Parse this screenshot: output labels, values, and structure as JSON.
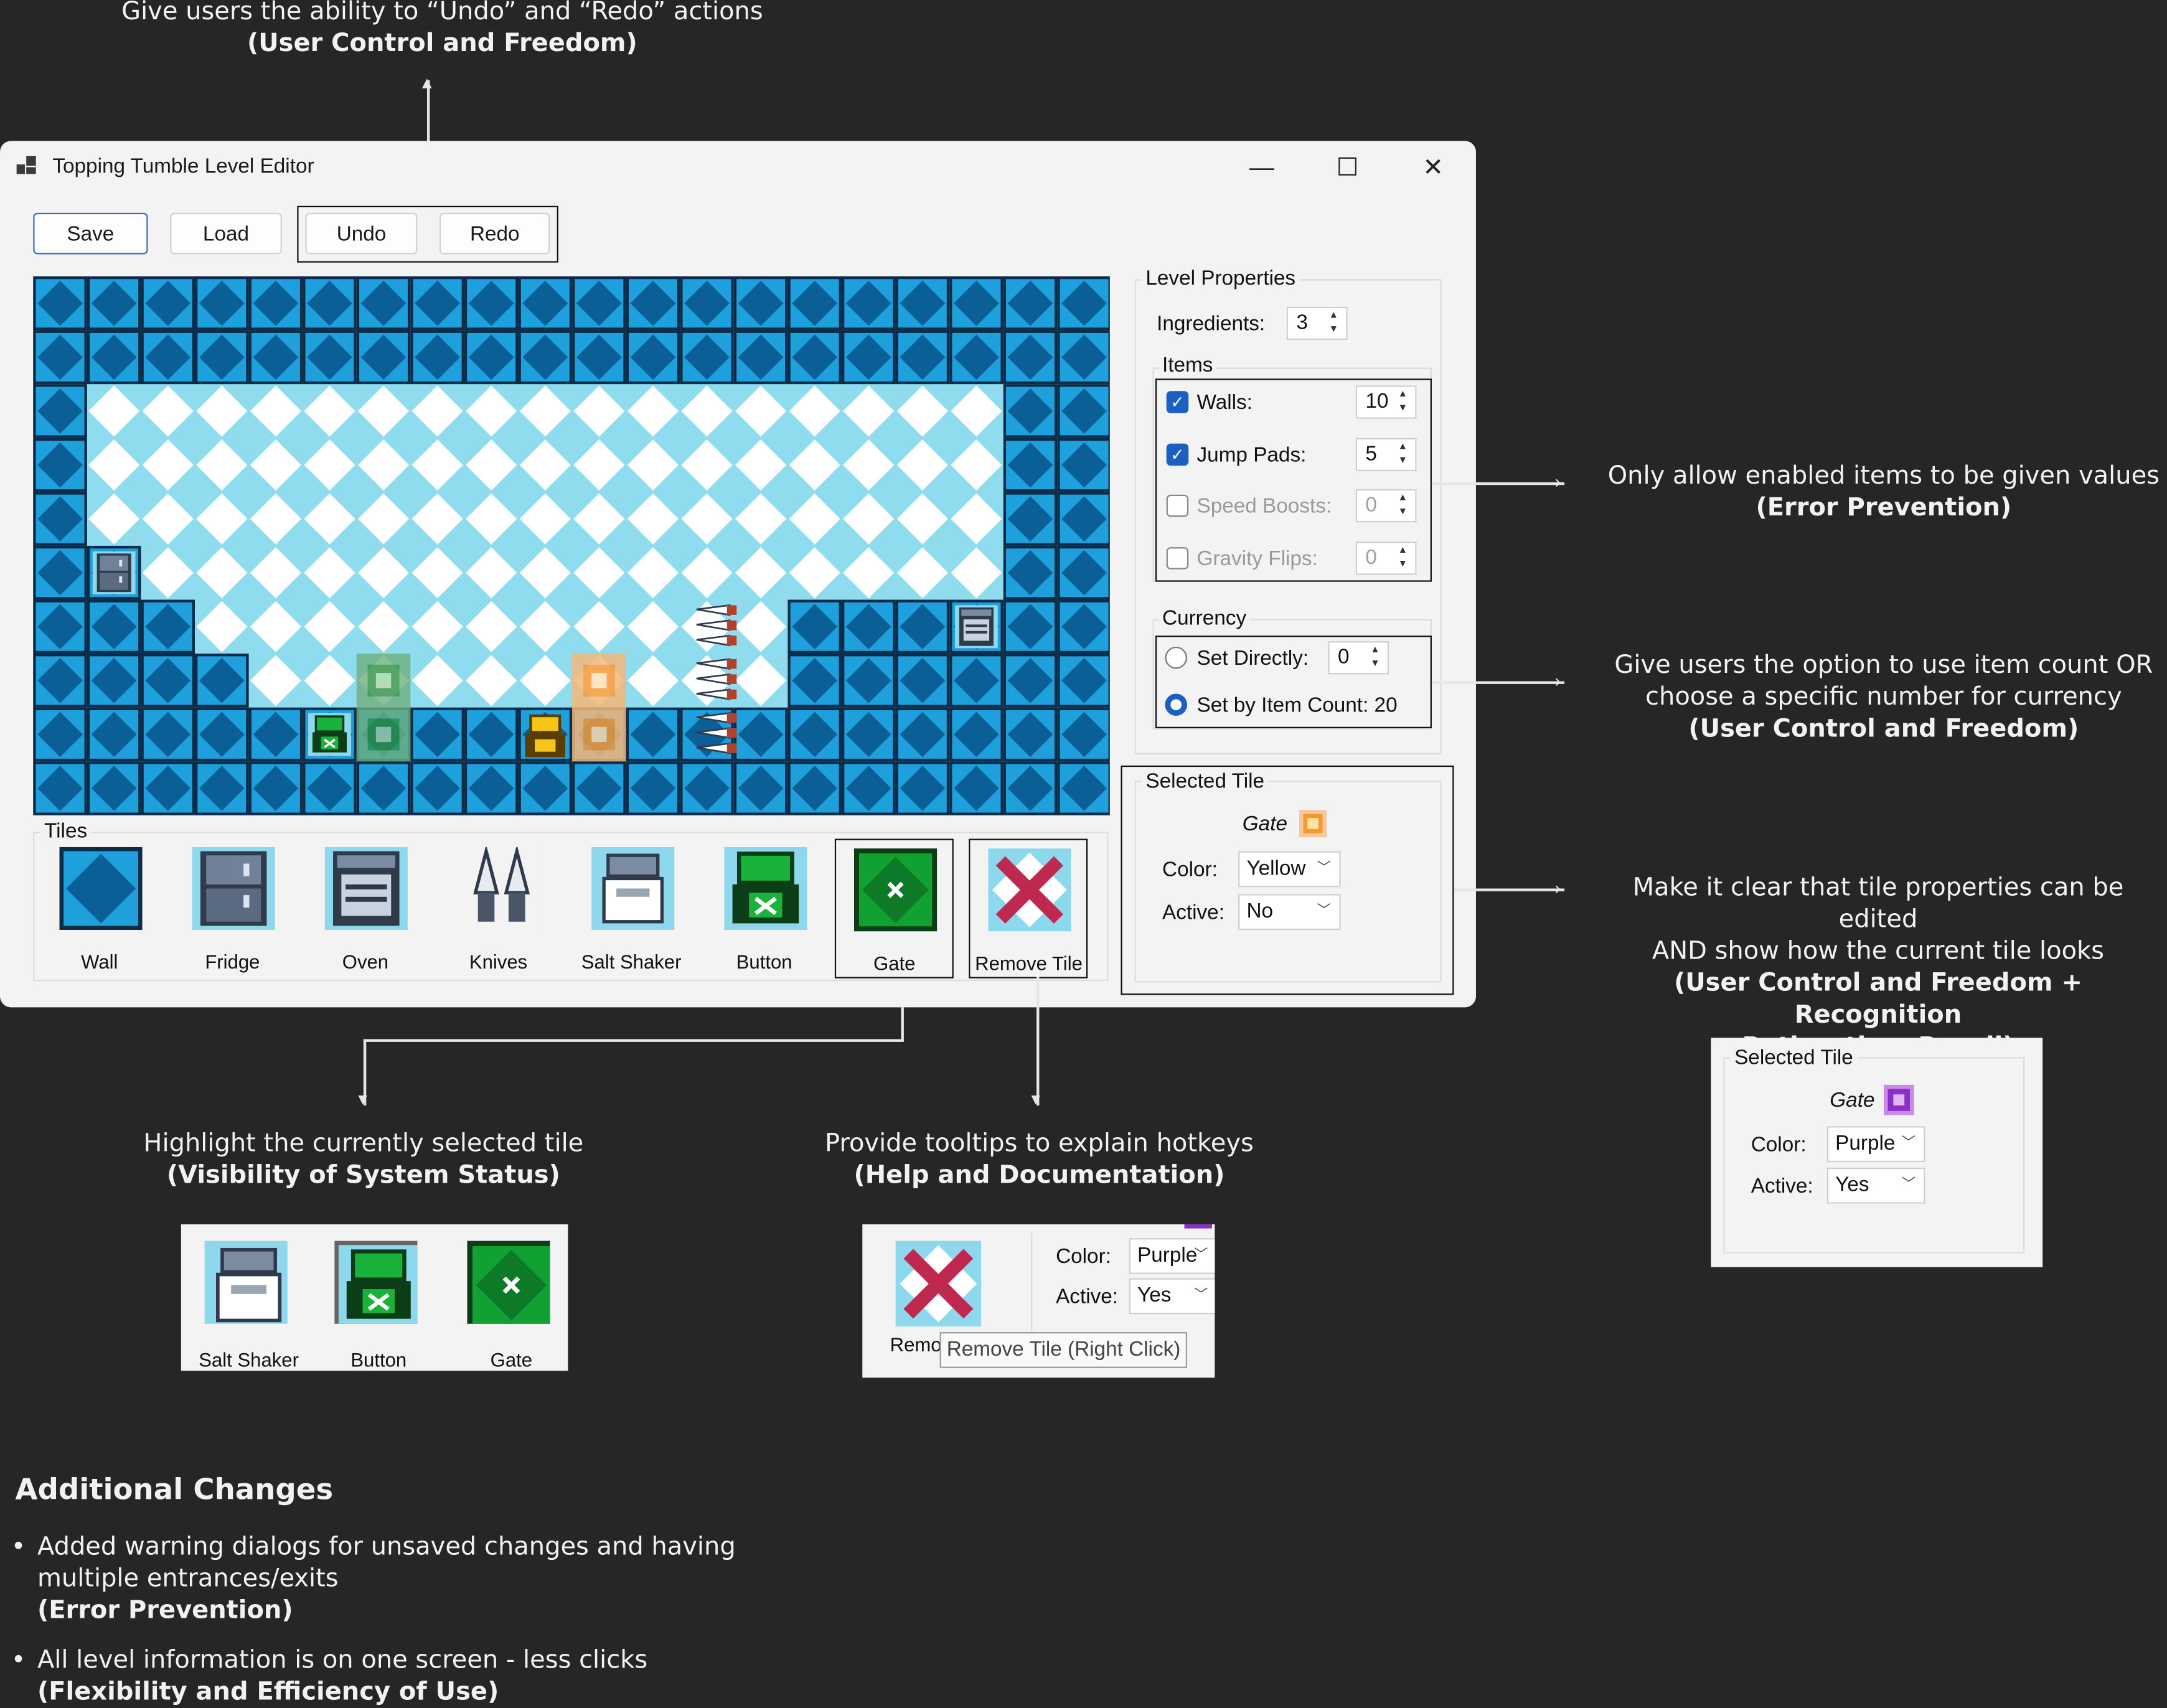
{
  "window": {
    "title": "Topping Tumble Level Editor",
    "minimize": "—",
    "maximize": "☐",
    "close": "✕"
  },
  "toolbar": {
    "save": "Save",
    "load": "Load",
    "undo": "Undo",
    "redo": "Redo"
  },
  "level_properties": {
    "title": "Level Properties",
    "ingredients_label": "Ingredients:",
    "ingredients_value": "3",
    "items_title": "Items",
    "items": [
      {
        "label": "Walls:",
        "checked": true,
        "value": "10"
      },
      {
        "label": "Jump Pads:",
        "checked": true,
        "value": "5"
      },
      {
        "label": "Speed Boosts:",
        "checked": false,
        "value": "0"
      },
      {
        "label": "Gravity Flips:",
        "checked": false,
        "value": "0"
      }
    ],
    "currency_title": "Currency",
    "set_directly_label": "Set Directly:",
    "set_directly_value": "0",
    "set_by_count_label": "Set by Item Count: 20"
  },
  "selected_tile": {
    "title": "Selected Tile",
    "name": "Gate",
    "color_label": "Color:",
    "color_value": "Yellow",
    "active_label": "Active:",
    "active_value": "No"
  },
  "tiles": {
    "title": "Tiles",
    "items": [
      "Wall",
      "Fridge",
      "Oven",
      "Knives",
      "Salt Shaker",
      "Button",
      "Gate",
      "Remove Tile"
    ]
  },
  "annotations": {
    "undo": {
      "line1": "Give users the ability to “Undo” and “Redo” actions",
      "bold": "(User Control and Freedom)"
    },
    "items": {
      "line1": "Only allow enabled items to be given values",
      "bold": "(Error Prevention)"
    },
    "currency": {
      "line1": "Give users the option to use item count OR",
      "line2": "choose a specific number for currency",
      "bold": "(User Control and Freedom)"
    },
    "selected": {
      "line1": "Make it clear that tile properties can be edited",
      "line2": "AND show how the current tile looks",
      "bold1": "(User Control and Freedom + Recognition",
      "bold2": "Rather than Recall)"
    },
    "highlight": {
      "line1": "Highlight the currently selected tile",
      "bold": "(Visibility of System Status)"
    },
    "tooltip": {
      "line1": "Provide tooltips to explain hotkeys",
      "bold": "(Help and Documentation)"
    }
  },
  "example_selected": {
    "title": "Selected Tile",
    "name": "Gate",
    "color_label": "Color:",
    "color_value": "Purple",
    "active_label": "Active:",
    "active_value": "Yes"
  },
  "example_highlight": {
    "items": [
      "Salt Shaker",
      "Button",
      "Gate"
    ]
  },
  "example_tooltip": {
    "color_label": "Color:",
    "color_value": "Purple",
    "active_label": "Active:",
    "active_value": "Yes",
    "cap_partial": "Remo",
    "tooltip": "Remove Tile (Right Click)"
  },
  "additional": {
    "title": "Additional Changes",
    "bullets": [
      {
        "text": "Added warning dialogs for unsaved changes and having multiple entrances/exits",
        "bold": "(Error Prevention)"
      },
      {
        "text": "All level information is on one screen - less clicks",
        "bold": "(Flexibility and Efficiency of Use)"
      }
    ]
  },
  "colors": {
    "wall": "#0a6aa8",
    "wall_light": "#1e90d0",
    "floor_a": "#ffffff",
    "floor_b": "#8fd7ec",
    "accent": "#1b5fc1",
    "gate_green": "#0d8a2a",
    "remove_red": "#c0294f"
  }
}
